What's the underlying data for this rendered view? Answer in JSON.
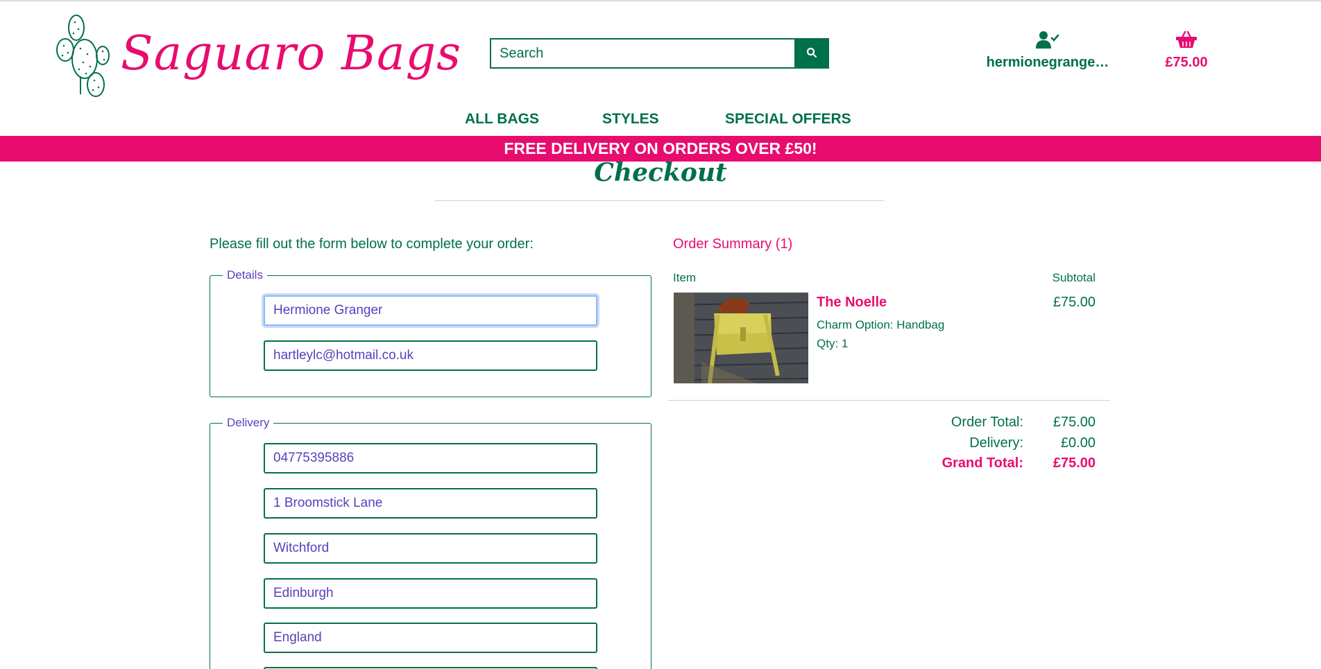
{
  "header": {
    "logo_text": "Saguaro Bags",
    "search_placeholder": "Search",
    "account_label": "hermionegrange…",
    "basket_total": "£75.00"
  },
  "nav": {
    "items": [
      "ALL BAGS",
      "STYLES",
      "SPECIAL OFFERS"
    ]
  },
  "banner": {
    "text": "FREE DELIVERY ON ORDERS OVER £50!"
  },
  "page": {
    "title": "Checkout",
    "intro": "Please fill out the form below to complete your order:"
  },
  "form": {
    "details_legend": "Details",
    "delivery_legend": "Delivery",
    "full_name": "Hermione Granger",
    "email": "hartleylc@hotmail.co.uk",
    "phone": "04775395886",
    "street_address": "1 Broomstick Lane",
    "town": "Witchford",
    "county": "Edinburgh",
    "country": "England"
  },
  "summary": {
    "title": "Order Summary (1)",
    "col_item": "Item",
    "col_subtotal": "Subtotal",
    "product": {
      "name": "The Noelle",
      "option": "Charm Option: Handbag",
      "qty": "Qty: 1",
      "subtotal": "£75.00"
    },
    "order_total_label": "Order Total:",
    "order_total": "£75.00",
    "delivery_label": "Delivery:",
    "delivery": "£0.00",
    "grand_total_label": "Grand Total:",
    "grand_total": "£75.00"
  },
  "colors": {
    "brand_green": "#00704a",
    "brand_pink": "#e80c6e",
    "field_text": "#5a3fbc"
  },
  "icons": {
    "search": "search-icon",
    "account": "user-check-icon",
    "basket": "basket-icon",
    "logo": "cactus-icon"
  }
}
